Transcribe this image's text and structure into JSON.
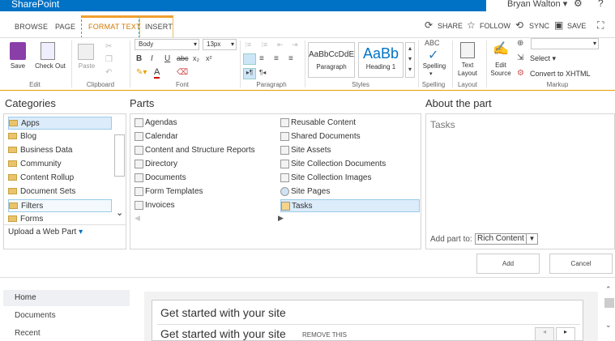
{
  "app": {
    "brand": "SharePoint",
    "user": "Bryan Walton"
  },
  "tabs": [
    "BROWSE",
    "PAGE",
    "FORMAT TEXT",
    "INSERT"
  ],
  "actions": {
    "share": "SHARE",
    "follow": "FOLLOW",
    "sync": "SYNC",
    "save": "SAVE"
  },
  "ribbon": {
    "edit": {
      "save": "Save",
      "checkout": "Check Out",
      "label": "Edit"
    },
    "clipboard": {
      "paste": "Paste",
      "label": "Clipboard"
    },
    "font": {
      "family": "Body",
      "size": "13px",
      "label": "Font"
    },
    "paragraph": {
      "label": "Paragraph"
    },
    "styles": {
      "style1_preview": "AaBbCcDdE",
      "style1_name": "Paragraph",
      "style2_preview": "AaBb",
      "style2_name": "Heading 1",
      "label": "Styles"
    },
    "spelling": {
      "abc": "ABC",
      "btn": "Spelling",
      "label": "Spelling"
    },
    "layout": {
      "btn": "Text Layout",
      "label": "Layout"
    },
    "markup": {
      "edit_source": "Edit Source",
      "select": "Select",
      "convert": "Convert to XHTML",
      "label": "Markup"
    }
  },
  "categories": {
    "title": "Categories",
    "items": [
      "Apps",
      "Blog",
      "Business Data",
      "Community",
      "Content Rollup",
      "Document Sets",
      "Filters",
      "Forms"
    ],
    "upload": "Upload a Web Part"
  },
  "parts": {
    "title": "Parts",
    "col1": [
      "Agendas",
      "Calendar",
      "Content and Structure Reports",
      "Directory",
      "Documents",
      "Form Templates",
      "Invoices"
    ],
    "col2": [
      "Reusable Content",
      "Shared Documents",
      "Site Assets",
      "Site Collection Documents",
      "Site Collection Images",
      "Site Pages",
      "Tasks"
    ]
  },
  "about": {
    "title": "About the part",
    "name": "Tasks",
    "add_part_to": "Add part to:",
    "dropdown": "Rich Content"
  },
  "buttons": {
    "add": "Add",
    "cancel": "Cancel"
  },
  "leftnav": [
    "Home",
    "Documents",
    "Recent"
  ],
  "getstarted": {
    "title": "Get started with your site",
    "title2": "Get started with your site",
    "remove": "REMOVE THIS"
  },
  "colors": {
    "accent": "#0072c6",
    "ribbon_border": "#e8a000",
    "selected_bg": "#dcecfb"
  }
}
